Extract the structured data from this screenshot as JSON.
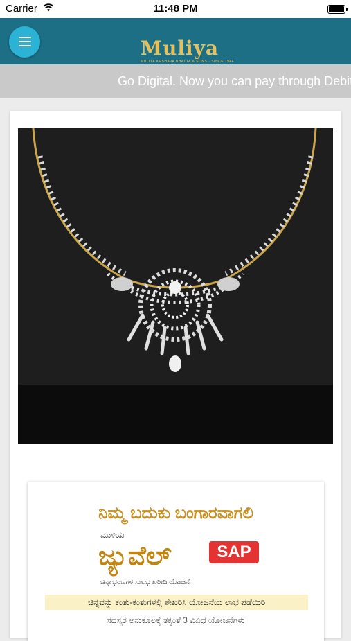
{
  "statusbar": {
    "carrier": "Carrier",
    "time": "11:48 PM"
  },
  "header": {
    "logo_text": "Muliya",
    "logo_tagline": "MULIYA KESHAVA BHATTA & SONS · SINCE 1944"
  },
  "ticker": {
    "text": "Go Digital. Now you can pay through Debit/C"
  },
  "promo": {
    "headline": "ನಿಮ್ಮ ಬದುಕು ಬಂಗಾರವಾಗಲಿ",
    "brand_small": "ಮುಳಿಯ",
    "brand_big": "ಜ್ಯುವೆಲ್",
    "badge": "SAP",
    "tagline": "ಚಿನ್ನಾಭರಣಗಳ ಸುಲಭ ಖರೀದಿ ಯೋಜನೆ",
    "band": "ಚಿನ್ನವನ್ನು ಕಂತು-ಕಂತುಗಳಲ್ಲಿ ಶೇಖರಿಸಿ ಯೋಜನೆಯ ಲಾಭ ಪಡೆಯಿರಿ",
    "line": "ಸದಸ್ಯರ ಅನುಕೂಲಕ್ಕೆ ತಕ್ಕಂತೆ 3 ವಿವಿಧ ಯೋಜನೆಗಳು"
  },
  "colors": {
    "appbar": "#1d6f86",
    "menu_button": "#2bb2d4",
    "gold": "#e3c161",
    "ticker_bg": "#c9c9c9",
    "badge": "#e33333"
  },
  "icons": {
    "menu": "hamburger-menu-icon",
    "wifi": "wifi-icon",
    "battery": "battery-icon"
  }
}
